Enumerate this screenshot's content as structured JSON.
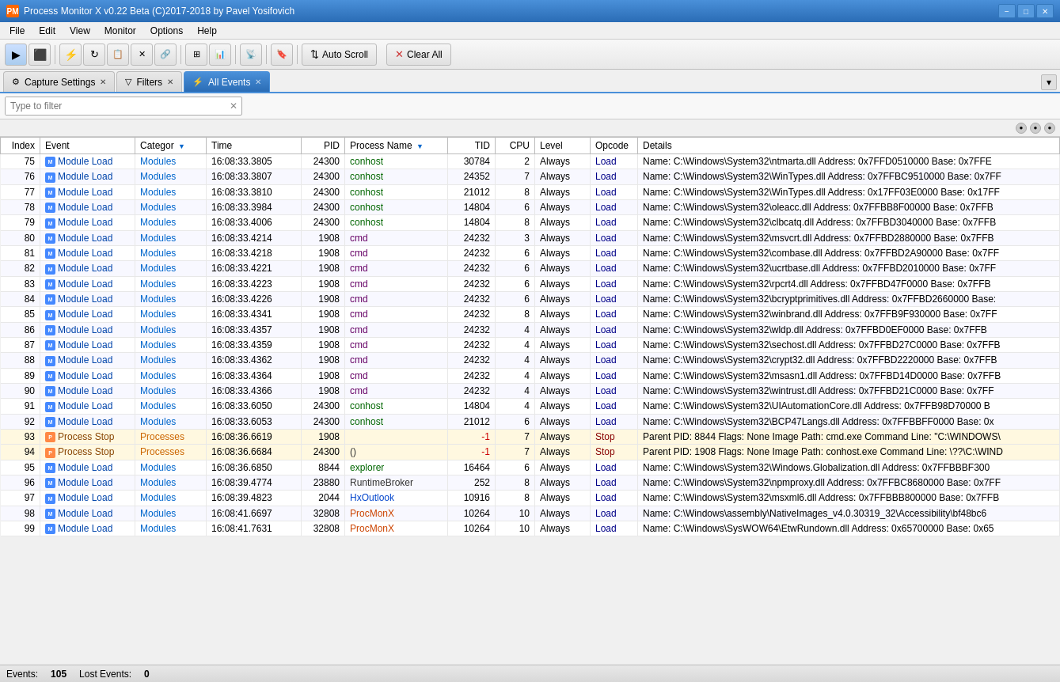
{
  "app": {
    "title": "Process Monitor X v0.22 Beta (C)2017-2018 by Pavel Yosifovich",
    "icon": "PM"
  },
  "titlebar": {
    "minimize": "−",
    "maximize": "□",
    "close": "✕"
  },
  "menu": {
    "items": [
      "File",
      "Edit",
      "View",
      "Monitor",
      "Options",
      "Help"
    ]
  },
  "toolbar": {
    "autoscroll_label": "Auto Scroll",
    "clearall_label": "Clear All",
    "buttons": [
      "▶",
      "⬛",
      "⚡",
      "↺",
      "📋",
      "✕",
      "🔗",
      "⊞",
      "📊",
      "📡",
      "🔖"
    ]
  },
  "tabs": {
    "items": [
      {
        "id": "capture",
        "label": "Capture Settings",
        "icon": "⚙",
        "active": false,
        "closable": true
      },
      {
        "id": "filters",
        "label": "Filters",
        "icon": "▽",
        "active": false,
        "closable": true
      },
      {
        "id": "allevents",
        "label": "All Events",
        "icon": "⚡",
        "active": true,
        "closable": true
      }
    ]
  },
  "filter": {
    "placeholder": "Type to filter",
    "value": ""
  },
  "table": {
    "columns": [
      "Index",
      "Event",
      "Categor",
      "Time",
      "PID",
      "Process Name",
      "TID",
      "CPU",
      "Level",
      "Opcode",
      "Details"
    ],
    "rows": [
      {
        "index": 75,
        "event": "Module Load",
        "category": "Modules",
        "time": "16:08:33.3805",
        "pid": 24300,
        "process": "conhost",
        "tid": 30784,
        "cpu": 2,
        "level": "Always",
        "opcode": "Load",
        "details": "Name: C:\\Windows\\System32\\ntmarta.dll Address: 0x7FFD0510000 Base: 0x7FFE",
        "cat_type": "modules",
        "event_type": "module"
      },
      {
        "index": 76,
        "event": "Module Load",
        "category": "Modules",
        "time": "16:08:33.3807",
        "pid": 24300,
        "process": "conhost",
        "tid": 24352,
        "cpu": 7,
        "level": "Always",
        "opcode": "Load",
        "details": "Name: C:\\Windows\\System32\\WinTypes.dll Address: 0x7FFBC9510000 Base: 0x7FF",
        "cat_type": "modules",
        "event_type": "module"
      },
      {
        "index": 77,
        "event": "Module Load",
        "category": "Modules",
        "time": "16:08:33.3810",
        "pid": 24300,
        "process": "conhost",
        "tid": 21012,
        "cpu": 8,
        "level": "Always",
        "opcode": "Load",
        "details": "Name: C:\\Windows\\System32\\WinTypes.dll Address: 0x17FF03E0000 Base: 0x17FF",
        "cat_type": "modules",
        "event_type": "module"
      },
      {
        "index": 78,
        "event": "Module Load",
        "category": "Modules",
        "time": "16:08:33.3984",
        "pid": 24300,
        "process": "conhost",
        "tid": 14804,
        "cpu": 6,
        "level": "Always",
        "opcode": "Load",
        "details": "Name: C:\\Windows\\System32\\oleacc.dll Address: 0x7FFBB8F00000 Base: 0x7FFB",
        "cat_type": "modules",
        "event_type": "module"
      },
      {
        "index": 79,
        "event": "Module Load",
        "category": "Modules",
        "time": "16:08:33.4006",
        "pid": 24300,
        "process": "conhost",
        "tid": 14804,
        "cpu": 8,
        "level": "Always",
        "opcode": "Load",
        "details": "Name: C:\\Windows\\System32\\clbcatq.dll Address: 0x7FFBD3040000 Base: 0x7FFB",
        "cat_type": "modules",
        "event_type": "module"
      },
      {
        "index": 80,
        "event": "Module Load",
        "category": "Modules",
        "time": "16:08:33.4214",
        "pid": 1908,
        "process": "cmd",
        "tid": 24232,
        "cpu": 3,
        "level": "Always",
        "opcode": "Load",
        "details": "Name: C:\\Windows\\System32\\msvcrt.dll Address: 0x7FFBD2880000 Base: 0x7FFB",
        "cat_type": "modules",
        "event_type": "module"
      },
      {
        "index": 81,
        "event": "Module Load",
        "category": "Modules",
        "time": "16:08:33.4218",
        "pid": 1908,
        "process": "cmd",
        "tid": 24232,
        "cpu": 6,
        "level": "Always",
        "opcode": "Load",
        "details": "Name: C:\\Windows\\System32\\combase.dll Address: 0x7FFBD2A90000 Base: 0x7FF",
        "cat_type": "modules",
        "event_type": "module"
      },
      {
        "index": 82,
        "event": "Module Load",
        "category": "Modules",
        "time": "16:08:33.4221",
        "pid": 1908,
        "process": "cmd",
        "tid": 24232,
        "cpu": 6,
        "level": "Always",
        "opcode": "Load",
        "details": "Name: C:\\Windows\\System32\\ucrtbase.dll Address: 0x7FFBD2010000 Base: 0x7FF",
        "cat_type": "modules",
        "event_type": "module"
      },
      {
        "index": 83,
        "event": "Module Load",
        "category": "Modules",
        "time": "16:08:33.4223",
        "pid": 1908,
        "process": "cmd",
        "tid": 24232,
        "cpu": 6,
        "level": "Always",
        "opcode": "Load",
        "details": "Name: C:\\Windows\\System32\\rpcrt4.dll Address: 0x7FFBD47F0000 Base: 0x7FFB",
        "cat_type": "modules",
        "event_type": "module"
      },
      {
        "index": 84,
        "event": "Module Load",
        "category": "Modules",
        "time": "16:08:33.4226",
        "pid": 1908,
        "process": "cmd",
        "tid": 24232,
        "cpu": 6,
        "level": "Always",
        "opcode": "Load",
        "details": "Name: C:\\Windows\\System32\\bcryptprimitives.dll Address: 0x7FFBD2660000 Base:",
        "cat_type": "modules",
        "event_type": "module"
      },
      {
        "index": 85,
        "event": "Module Load",
        "category": "Modules",
        "time": "16:08:33.4341",
        "pid": 1908,
        "process": "cmd",
        "tid": 24232,
        "cpu": 8,
        "level": "Always",
        "opcode": "Load",
        "details": "Name: C:\\Windows\\System32\\winbrand.dll Address: 0x7FFB9F930000 Base: 0x7FF",
        "cat_type": "modules",
        "event_type": "module"
      },
      {
        "index": 86,
        "event": "Module Load",
        "category": "Modules",
        "time": "16:08:33.4357",
        "pid": 1908,
        "process": "cmd",
        "tid": 24232,
        "cpu": 4,
        "level": "Always",
        "opcode": "Load",
        "details": "Name: C:\\Windows\\System32\\wldp.dll Address: 0x7FFBD0EF0000 Base: 0x7FFB",
        "cat_type": "modules",
        "event_type": "module"
      },
      {
        "index": 87,
        "event": "Module Load",
        "category": "Modules",
        "time": "16:08:33.4359",
        "pid": 1908,
        "process": "cmd",
        "tid": 24232,
        "cpu": 4,
        "level": "Always",
        "opcode": "Load",
        "details": "Name: C:\\Windows\\System32\\sechost.dll Address: 0x7FFBD27C0000 Base: 0x7FFB",
        "cat_type": "modules",
        "event_type": "module"
      },
      {
        "index": 88,
        "event": "Module Load",
        "category": "Modules",
        "time": "16:08:33.4362",
        "pid": 1908,
        "process": "cmd",
        "tid": 24232,
        "cpu": 4,
        "level": "Always",
        "opcode": "Load",
        "details": "Name: C:\\Windows\\System32\\crypt32.dll Address: 0x7FFBD2220000 Base: 0x7FFB",
        "cat_type": "modules",
        "event_type": "module"
      },
      {
        "index": 89,
        "event": "Module Load",
        "category": "Modules",
        "time": "16:08:33.4364",
        "pid": 1908,
        "process": "cmd",
        "tid": 24232,
        "cpu": 4,
        "level": "Always",
        "opcode": "Load",
        "details": "Name: C:\\Windows\\System32\\msasn1.dll Address: 0x7FFBD14D0000 Base: 0x7FFB",
        "cat_type": "modules",
        "event_type": "module"
      },
      {
        "index": 90,
        "event": "Module Load",
        "category": "Modules",
        "time": "16:08:33.4366",
        "pid": 1908,
        "process": "cmd",
        "tid": 24232,
        "cpu": 4,
        "level": "Always",
        "opcode": "Load",
        "details": "Name: C:\\Windows\\System32\\wintrust.dll Address: 0x7FFBD21C0000 Base: 0x7FF",
        "cat_type": "modules",
        "event_type": "module"
      },
      {
        "index": 91,
        "event": "Module Load",
        "category": "Modules",
        "time": "16:08:33.6050",
        "pid": 24300,
        "process": "conhost",
        "tid": 14804,
        "cpu": 4,
        "level": "Always",
        "opcode": "Load",
        "details": "Name: C:\\Windows\\System32\\UIAutomationCore.dll Address: 0x7FFB98D70000 B",
        "cat_type": "modules",
        "event_type": "module"
      },
      {
        "index": 92,
        "event": "Module Load",
        "category": "Modules",
        "time": "16:08:33.6053",
        "pid": 24300,
        "process": "conhost",
        "tid": 21012,
        "cpu": 6,
        "level": "Always",
        "opcode": "Load",
        "details": "Name: C:\\Windows\\System32\\BCP47Langs.dll Address: 0x7FFBBFF0000 Base: 0x",
        "cat_type": "modules",
        "event_type": "module"
      },
      {
        "index": 93,
        "event": "Process Stop",
        "category": "Processes",
        "time": "16:08:36.6619",
        "pid": 1908,
        "process": "",
        "tid": -1,
        "cpu": 7,
        "level": "Always",
        "opcode": "Stop",
        "details": "Parent PID: 8844 Flags: None Image Path: cmd.exe Command Line: \"C:\\WINDOWS\\",
        "cat_type": "processes",
        "event_type": "process",
        "row_type": "process-stop"
      },
      {
        "index": 94,
        "event": "Process Stop",
        "category": "Processes",
        "time": "16:08:36.6684",
        "pid": 24300,
        "process": "()",
        "tid": -1,
        "cpu": 7,
        "level": "Always",
        "opcode": "Stop",
        "details": "Parent PID: 1908 Flags: None Image Path: conhost.exe Command Line: \\??\\C:\\WIND",
        "cat_type": "processes",
        "event_type": "process",
        "row_type": "process-stop"
      },
      {
        "index": 95,
        "event": "Module Load",
        "category": "Modules",
        "time": "16:08:36.6850",
        "pid": 8844,
        "process": "explorer",
        "tid": 16464,
        "cpu": 6,
        "level": "Always",
        "opcode": "Load",
        "details": "Name: C:\\Windows\\System32\\Windows.Globalization.dll Address: 0x7FFBBBF300",
        "cat_type": "modules",
        "event_type": "module"
      },
      {
        "index": 96,
        "event": "Module Load",
        "category": "Modules",
        "time": "16:08:39.4774",
        "pid": 23880,
        "process": "RuntimeBroker",
        "tid": 252,
        "cpu": 8,
        "level": "Always",
        "opcode": "Load",
        "details": "Name: C:\\Windows\\System32\\npmproxy.dll Address: 0x7FFBC8680000 Base: 0x7FF",
        "cat_type": "modules",
        "event_type": "module"
      },
      {
        "index": 97,
        "event": "Module Load",
        "category": "Modules",
        "time": "16:08:39.4823",
        "pid": 2044,
        "process": "HxOutlook",
        "tid": 10916,
        "cpu": 8,
        "level": "Always",
        "opcode": "Load",
        "details": "Name: C:\\Windows\\System32\\msxml6.dll Address: 0x7FFBBB800000 Base: 0x7FFB",
        "cat_type": "modules",
        "event_type": "module"
      },
      {
        "index": 98,
        "event": "Module Load",
        "category": "Modules",
        "time": "16:08:41.6697",
        "pid": 32808,
        "process": "ProcMonX",
        "tid": 10264,
        "cpu": 10,
        "level": "Always",
        "opcode": "Load",
        "details": "Name: C:\\Windows\\assembly\\NativeImages_v4.0.30319_32\\Accessibility\\bf48bc6",
        "cat_type": "modules",
        "event_type": "module"
      },
      {
        "index": 99,
        "event": "Module Load",
        "category": "Modules",
        "time": "16:08:41.7631",
        "pid": 32808,
        "process": "ProcMonX",
        "tid": 10264,
        "cpu": 10,
        "level": "Always",
        "opcode": "Load",
        "details": "Name: C:\\Windows\\SysWOW64\\EtwRundown.dll Address: 0x65700000 Base: 0x65",
        "cat_type": "modules",
        "event_type": "module"
      }
    ]
  },
  "statusbar": {
    "events_label": "Events:",
    "events_count": "105",
    "lost_label": "Lost Events:",
    "lost_count": "0"
  },
  "scroll_dots": [
    "●",
    "●",
    "●"
  ]
}
